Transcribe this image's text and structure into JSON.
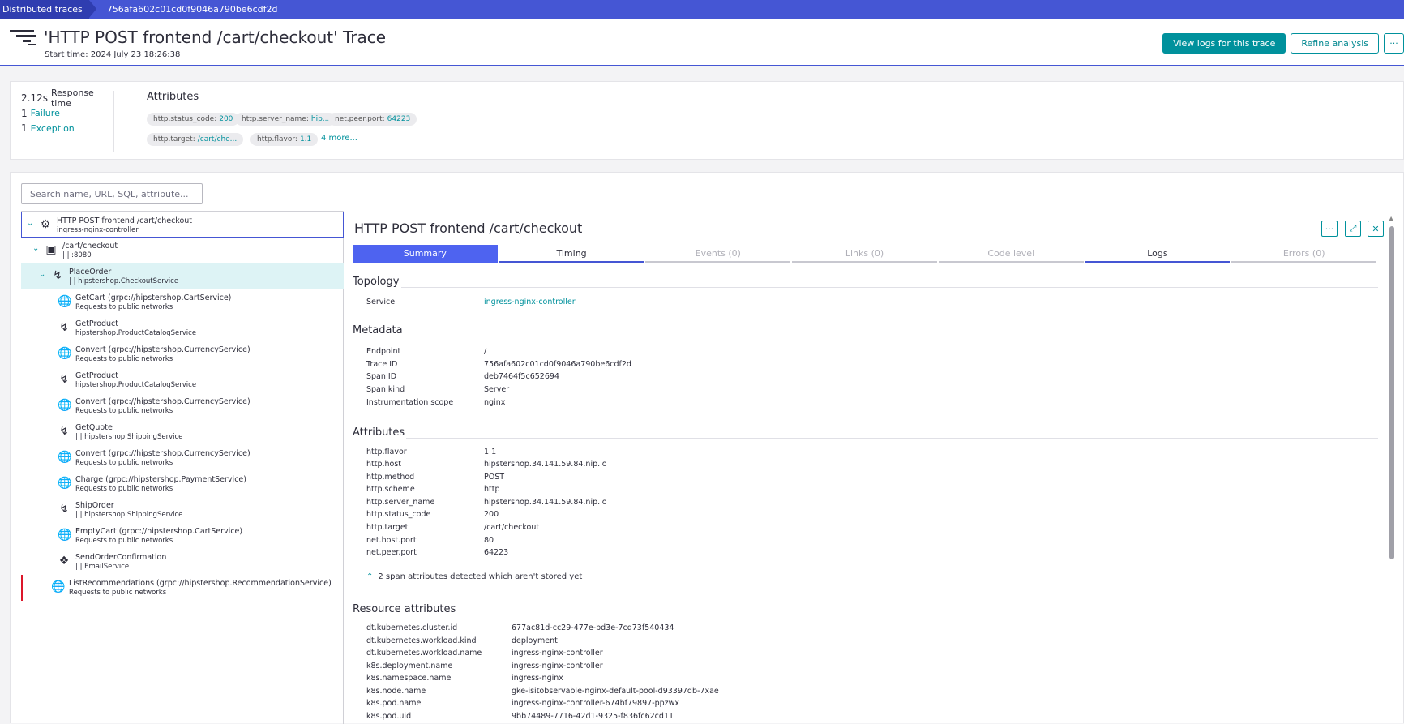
{
  "breadcrumb": {
    "root": "Distributed traces",
    "current": "756afa602c01cd0f9046a790be6cdf2d"
  },
  "header": {
    "title": "'HTTP POST frontend /cart/checkout' Trace",
    "start_time": "Start time: 2024 July 23 18:26:38",
    "view_logs_label": "View logs for this trace",
    "refine_label": "Refine analysis",
    "more_label": "···"
  },
  "summary": {
    "response_time_value": "2.12s",
    "response_time_label": "Response time",
    "failure_count": "1",
    "failure_label": "Failure",
    "exception_count": "1",
    "exception_label": "Exception",
    "attributes_title": "Attributes",
    "chips": [
      {
        "key": "http.status_code:",
        "value": "200"
      },
      {
        "key": "http.server_name:",
        "value": "hip..."
      },
      {
        "key": "net.peer.port:",
        "value": "64223"
      },
      {
        "key": "http.target:",
        "value": "/cart/che..."
      },
      {
        "key": "http.flavor:",
        "value": "1.1"
      }
    ],
    "more_link": "4 more..."
  },
  "search": {
    "placeholder": "Search name, URL, SQL, attribute..."
  },
  "tree": [
    {
      "name": "HTTP POST frontend /cart/checkout",
      "sub": "ingress-nginx-controller",
      "icon": "gear-icon"
    },
    {
      "name": "/cart/checkout",
      "sub": "| | :8080",
      "icon": "container-icon"
    },
    {
      "name": "PlaceOrder",
      "sub": "| | hipstershop.CheckoutService",
      "icon": "service-icon"
    },
    {
      "name": "GetCart (grpc://hipstershop.CartService)",
      "sub": "Requests to public networks",
      "icon": "globe-icon"
    },
    {
      "name": "GetProduct",
      "sub": "hipstershop.ProductCatalogService",
      "icon": "service-icon"
    },
    {
      "name": "Convert (grpc://hipstershop.CurrencyService)",
      "sub": "Requests to public networks",
      "icon": "globe-icon"
    },
    {
      "name": "GetProduct",
      "sub": "hipstershop.ProductCatalogService",
      "icon": "service-icon"
    },
    {
      "name": "Convert (grpc://hipstershop.CurrencyService)",
      "sub": "Requests to public networks",
      "icon": "globe-icon"
    },
    {
      "name": "GetQuote",
      "sub": "| | hipstershop.ShippingService",
      "icon": "service-icon"
    },
    {
      "name": "Convert (grpc://hipstershop.CurrencyService)",
      "sub": "Requests to public networks",
      "icon": "globe-icon"
    },
    {
      "name": "Charge (grpc://hipstershop.PaymentService)",
      "sub": "Requests to public networks",
      "icon": "globe-icon"
    },
    {
      "name": "ShipOrder",
      "sub": "| | hipstershop.ShippingService",
      "icon": "service-icon"
    },
    {
      "name": "EmptyCart (grpc://hipstershop.CartService)",
      "sub": "Requests to public networks",
      "icon": "globe-icon"
    },
    {
      "name": "SendOrderConfirmation",
      "sub": "| | EmailService",
      "icon": "python-icon"
    },
    {
      "name": "ListRecommendations (grpc://hipstershop.RecommendationService)",
      "sub": "Requests to public networks",
      "icon": "globe-icon"
    }
  ],
  "detail": {
    "title": "HTTP POST frontend /cart/checkout",
    "tabs": [
      "Summary",
      "Timing",
      "Events (0)",
      "Links (0)",
      "Code level",
      "Logs",
      "Errors (0)"
    ],
    "topology_title": "Topology",
    "topology": [
      {
        "key": "Service",
        "value": "ingress-nginx-controller"
      }
    ],
    "metadata_title": "Metadata",
    "metadata": [
      {
        "key": "Endpoint",
        "value": "/"
      },
      {
        "key": "Trace ID",
        "value": "756afa602c01cd0f9046a790be6cdf2d"
      },
      {
        "key": "Span ID",
        "value": "deb7464f5c652694"
      },
      {
        "key": "Span kind",
        "value": "Server"
      },
      {
        "key": "Instrumentation scope",
        "value": "nginx"
      }
    ],
    "attributes_title": "Attributes",
    "attributes": [
      {
        "key": "http.flavor",
        "value": "1.1"
      },
      {
        "key": "http.host",
        "value": "hipstershop.34.141.59.84.nip.io"
      },
      {
        "key": "http.method",
        "value": "POST"
      },
      {
        "key": "http.scheme",
        "value": "http"
      },
      {
        "key": "http.server_name",
        "value": "hipstershop.34.141.59.84.nip.io"
      },
      {
        "key": "http.status_code",
        "value": "200"
      },
      {
        "key": "http.target",
        "value": "/cart/checkout"
      },
      {
        "key": "net.host.port",
        "value": "80"
      },
      {
        "key": "net.peer.port",
        "value": "64223"
      }
    ],
    "not_stored_note": "2 span attributes detected which aren't stored yet",
    "resource_title": "Resource attributes",
    "resource": [
      {
        "key": "dt.kubernetes.cluster.id",
        "value": "677ac81d-cc29-477e-bd3e-7cd73f540434"
      },
      {
        "key": "dt.kubernetes.workload.kind",
        "value": "deployment"
      },
      {
        "key": "dt.kubernetes.workload.name",
        "value": "ingress-nginx-controller"
      },
      {
        "key": "k8s.deployment.name",
        "value": "ingress-nginx-controller"
      },
      {
        "key": "k8s.namespace.name",
        "value": "ingress-nginx"
      },
      {
        "key": "k8s.node.name",
        "value": "gke-isitobservable-nginx-default-pool-d93397db-7xae"
      },
      {
        "key": "k8s.pod.name",
        "value": "ingress-nginx-controller-674bf79897-ppzwx"
      },
      {
        "key": "k8s.pod.uid",
        "value": "9bb74489-7716-42d1-9325-f836fc62cd11"
      }
    ]
  }
}
